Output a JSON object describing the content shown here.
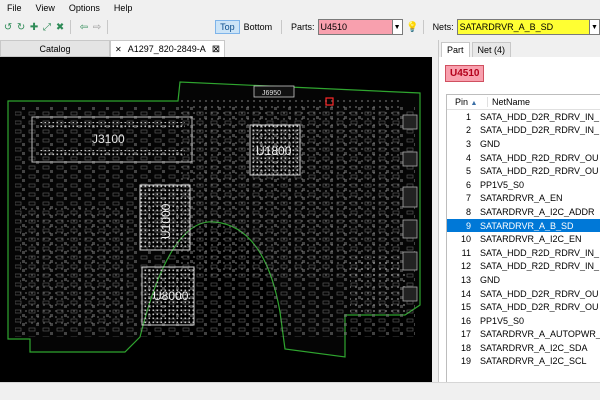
{
  "menu": [
    "File",
    "View",
    "Options",
    "Help"
  ],
  "toolbar": {
    "top_label": "Top",
    "bottom_label": "Bottom",
    "parts_label": "Parts:",
    "parts_value": "U4510",
    "nets_label": "Nets:",
    "nets_value": "SATARDRVR_A_B_SD"
  },
  "tabs": {
    "catalog": "Catalog",
    "board": "A1297_820-2849-A"
  },
  "board_labels": {
    "j3100": "J3100",
    "u1800": "U1800",
    "u1000": "U1000",
    "u8000": "U8000",
    "j6950": "J6950"
  },
  "side_panel": {
    "tab_part": "Part",
    "tab_net": "Net (4)",
    "part_name": "U4510",
    "col_pin": "Pin",
    "col_netname": "NetName",
    "selected_pin": "9",
    "rows": [
      {
        "pin": "1",
        "net": "SATA_HDD_D2R_RDRV_IN_"
      },
      {
        "pin": "2",
        "net": "SATA_HDD_D2R_RDRV_IN_"
      },
      {
        "pin": "3",
        "net": "GND"
      },
      {
        "pin": "4",
        "net": "SATA_HDD_R2D_RDRV_OU"
      },
      {
        "pin": "5",
        "net": "SATA_HDD_R2D_RDRV_OU"
      },
      {
        "pin": "6",
        "net": "PP1V5_S0"
      },
      {
        "pin": "7",
        "net": "SATARDRVR_A_EN"
      },
      {
        "pin": "8",
        "net": "SATARDRVR_A_I2C_ADDR"
      },
      {
        "pin": "9",
        "net": "SATARDRVR_A_B_SD"
      },
      {
        "pin": "10",
        "net": "SATARDRVR_A_I2C_EN"
      },
      {
        "pin": "11",
        "net": "SATA_HDD_R2D_RDRV_IN_"
      },
      {
        "pin": "12",
        "net": "SATA_HDD_R2D_RDRV_IN_"
      },
      {
        "pin": "13",
        "net": "GND"
      },
      {
        "pin": "14",
        "net": "SATA_HDD_D2R_RDRV_OU"
      },
      {
        "pin": "15",
        "net": "SATA_HDD_D2R_RDRV_OU"
      },
      {
        "pin": "16",
        "net": "PP1V5_S0"
      },
      {
        "pin": "17",
        "net": "SATARDRVR_A_AUTOPWR_I"
      },
      {
        "pin": "18",
        "net": "SATARDRVR_A_I2C_SDA"
      },
      {
        "pin": "19",
        "net": "SATARDRVR_A_I2C_SCL"
      }
    ]
  },
  "colors": {
    "parts_bg": "#f8a0ae",
    "nets_bg": "#ffff33",
    "selection": "#0078d7",
    "board_outline": "#2fa52f"
  }
}
